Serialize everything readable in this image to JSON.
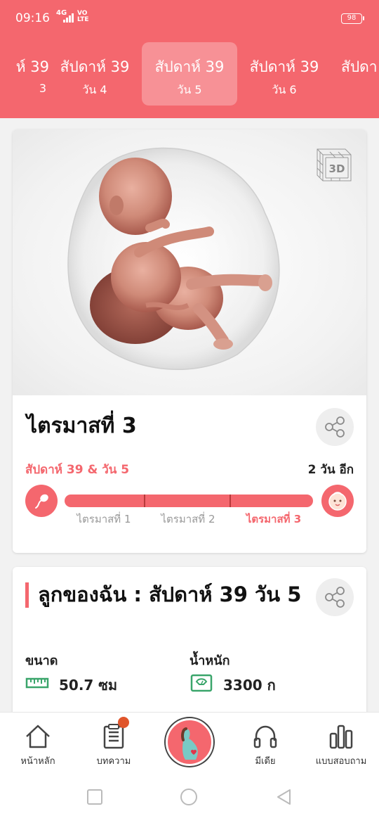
{
  "status": {
    "time": "09:16",
    "network": "4G",
    "volte": "VO\nLTE",
    "battery": "98"
  },
  "tabs": [
    {
      "week": "ห์ 39",
      "day": "3"
    },
    {
      "week": "สัปดาห์ 39",
      "day": "วัน 4"
    },
    {
      "week": "สัปดาห์ 39",
      "day": "วัน 5",
      "active": true
    },
    {
      "week": "สัปดาห์ 39",
      "day": "วัน 6"
    },
    {
      "week": "สัปดา",
      "day": ""
    }
  ],
  "card1": {
    "badge": "3D",
    "trimester_title": "ไตรมาสที่ 3",
    "progress_label": "สัปดาห์ 39 & วัน 5",
    "remaining": "2 วัน อีก",
    "progress_value": 1.0,
    "trimester_labels": [
      "ไตรมาสที่ 1",
      "ไตรมาสที่ 2",
      "ไตรมาสที่ 3"
    ],
    "active_trimester": 3
  },
  "card2": {
    "title": "ลูกของฉัน : สัปดาห์ 39 วัน 5",
    "size_label": "ขนาด",
    "size_value": "50.7 ซม",
    "weight_label": "น้ำหนัก",
    "weight_value": "3300 ก"
  },
  "bottom_nav": {
    "home": "หน้าหลัก",
    "articles": "บทความ",
    "media": "มีเดีย",
    "survey": "แบบสอบถาม"
  },
  "colors": {
    "brand": "#f4676e",
    "notification": "#e0552b",
    "green": "#3aa56b"
  }
}
